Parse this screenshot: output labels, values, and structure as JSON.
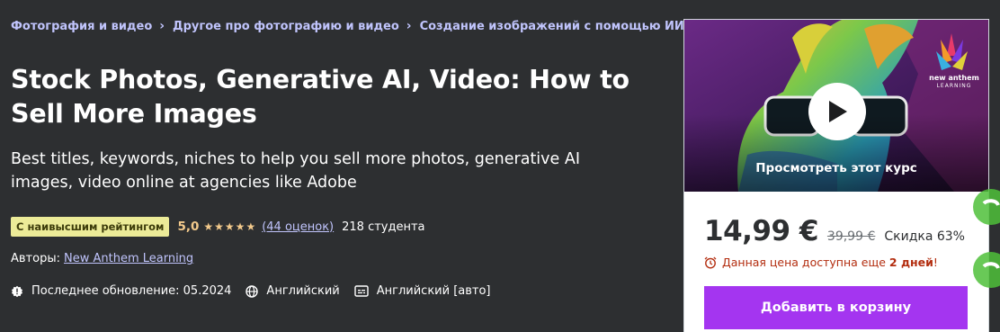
{
  "breadcrumb": [
    {
      "label": "Фотография и видео"
    },
    {
      "label": "Другое про фотографию и видео"
    },
    {
      "label": "Создание изображений с помощью ИИ"
    }
  ],
  "course": {
    "title": "Stock Photos, Generative AI, Video: How to Sell More Images",
    "subtitle": "Best titles, keywords, niches to help you sell more photos, generative AI images, video online at agencies like Adobe",
    "badge": "С наивысшим рейтингом",
    "rating": "5,0",
    "stars": 5,
    "rating_count": "(44 оценок)",
    "students": "218 студента",
    "authors_label": "Авторы:",
    "author": "New Anthem Learning",
    "last_updated": "Последнее обновление: 05.2024",
    "language": "Английский",
    "captions": "Английский [авто]"
  },
  "card": {
    "preview_label": "Просмотреть этот курс",
    "brand_text": "new anthem",
    "brand_sub": "LEARNING",
    "price": "14,99 €",
    "old_price": "39,99 €",
    "discount": "Скидка 63%",
    "timer_prefix": "Данная цена доступна еще",
    "timer_days": "2 дней",
    "timer_suffix": "!",
    "add_to_cart": "Добавить в корзину"
  },
  "colors": {
    "background": "#2d2f31",
    "link": "#c0c4fc",
    "badge": "#eceb98",
    "rating": "#f3ca8c",
    "accent_button": "#a435f0",
    "timer_red": "#b32d0f"
  },
  "icons": {
    "breadcrumb_separator": "chevron-right-icon",
    "update": "alert-badge-icon",
    "language": "globe-icon",
    "captions": "closed-captions-icon",
    "preview": "play-icon",
    "timer": "alarm-clock-icon"
  }
}
